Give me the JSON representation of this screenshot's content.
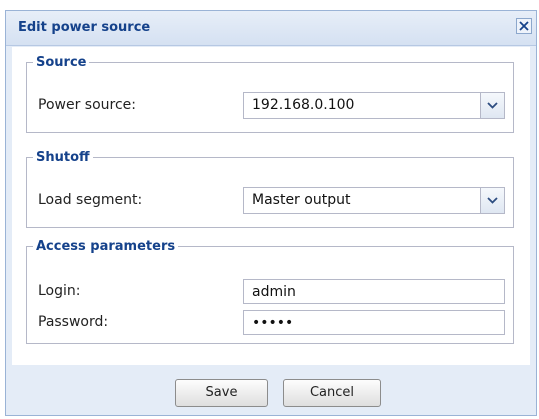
{
  "dialog": {
    "title": "Edit power source",
    "close_icon": "close-icon"
  },
  "source": {
    "legend": "Source",
    "power_source_label": "Power source:",
    "power_source_value": "192.168.0.100",
    "dropdown_icon": "chevron-down-icon"
  },
  "shutoff": {
    "legend": "Shutoff",
    "load_segment_label": "Load segment:",
    "load_segment_value": "Master output",
    "dropdown_icon": "chevron-down-icon"
  },
  "access": {
    "legend": "Access parameters",
    "login_label": "Login:",
    "login_value": "admin",
    "password_label": "Password:",
    "password_value": "•••••"
  },
  "buttons": {
    "save_label": "Save",
    "cancel_label": "Cancel"
  },
  "colors": {
    "accent": "#15428b",
    "frame": "#e4ecf7",
    "border": "#b5b8c8"
  }
}
